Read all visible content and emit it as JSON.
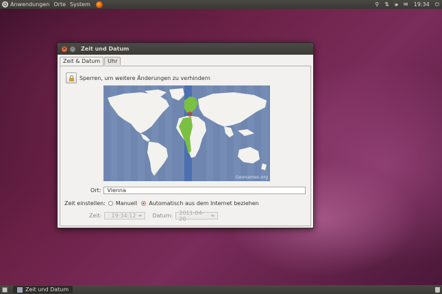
{
  "top_panel": {
    "menus": [
      "Anwendungen",
      "Orte",
      "System"
    ],
    "clock": "19:34"
  },
  "window": {
    "title": "Zeit und Datum",
    "tabs": [
      {
        "label": "Zeit & Datum",
        "active": true
      },
      {
        "label": "Uhr",
        "active": false
      }
    ],
    "lock_label": "Sperren, um weitere Änderungen zu verhindern",
    "map_credit": "Geonames.org",
    "location_label": "Ort:",
    "location_value": "Vienna",
    "set_time_label": "Zeit einstellen:",
    "radio_manual": "Manuell",
    "radio_auto": "Automatisch aus dem Internet beziehen",
    "selected_mode": "auto",
    "time_label": "Zeit:",
    "time_value": "19:34:12",
    "date_label": "Datum:",
    "date_value": "2011-04-20"
  },
  "bottom_panel": {
    "task_label": "Zeit und Datum"
  },
  "colors": {
    "accent": "#e05a1e",
    "panel": "#3c3b37",
    "map_ocean": "#6f87b0",
    "timezone_highlight": "#7ac043"
  }
}
